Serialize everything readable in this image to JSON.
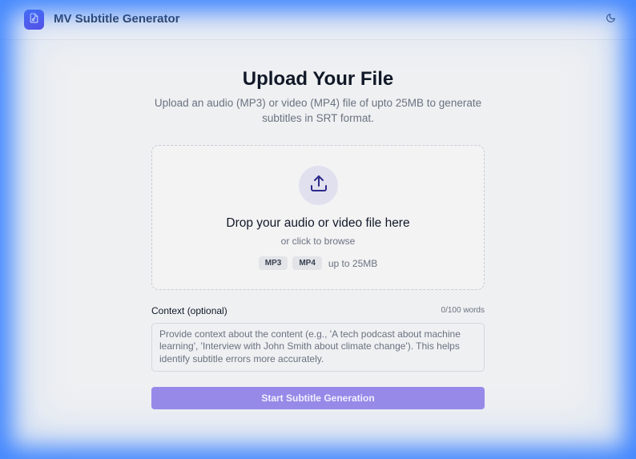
{
  "header": {
    "app_title": "MV Subtitle Generator",
    "logo_icon": "audio-file-icon",
    "theme_toggle_icon": "moon-icon"
  },
  "main": {
    "title": "Upload Your File",
    "subtitle": "Upload an audio (MP3) or video (MP4) file of upto 25MB to generate subtitles in SRT format."
  },
  "dropzone": {
    "icon": "upload-icon",
    "title": "Drop your audio or video file here",
    "subtitle": "or click to browse",
    "formats": [
      "MP3",
      "MP4"
    ],
    "size_note": "up to 25MB"
  },
  "context": {
    "label": "Context (optional)",
    "word_count": "0/100 words",
    "value": "",
    "placeholder": "Provide context about the content (e.g., 'A tech podcast about machine learning', 'Interview with John Smith about climate change'). This helps identify subtitle errors more accurately."
  },
  "actions": {
    "start_label": "Start Subtitle Generation"
  },
  "colors": {
    "accent": "#4f46e5",
    "button_disabled": "#978ae8",
    "glow": "#2a78ff"
  }
}
